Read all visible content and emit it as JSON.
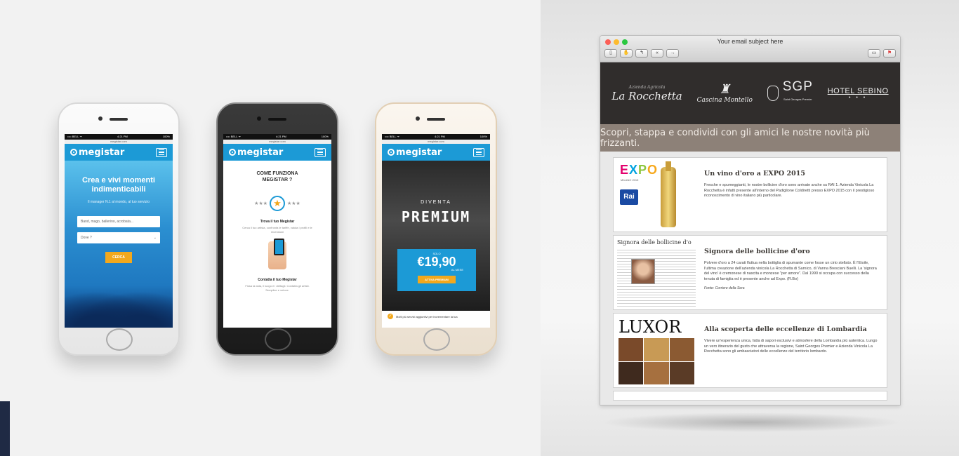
{
  "phones": {
    "p1": {
      "status_left": "•••• BELL ᯤ",
      "status_time": "4:21 PM",
      "status_right": "100%",
      "url": "megistar.com",
      "logo": "megistar",
      "headline": "Crea e vivi momenti indimenticabili",
      "subline": "Il manager N.1 al mondo, al tuo servizio",
      "search_placeholder": "Band, mago, ballerino, acrobata...",
      "where_placeholder": "Dove ?",
      "search_button": "CERCA"
    },
    "p2": {
      "status_left": "•••• BELL ᯤ",
      "status_time": "4:21 PM",
      "status_right": "100%",
      "url": "megistar.com",
      "logo": "megistar",
      "headline": "COME FUNZIONA MEGISTAR ?",
      "step1_title": "Trova il tuo Megistar",
      "step1_text": "Cerca il tuo artista, confronta le tariffe, valuta i profili e le recensioni",
      "step2_title": "Contatta il tuo Megistar",
      "step2_text": "Fissa la data, il luogo e i dettagli. Contatta gli artisti. Semplice e veloce."
    },
    "p3": {
      "status_left": "•••• BELL ᯤ",
      "status_time": "4:21 PM",
      "status_right": "100%",
      "url": "megistar.com",
      "logo": "megistar",
      "diventa": "DIVENTA",
      "premium": "PREMIUM",
      "solo": "SOLO",
      "price": "€19,90",
      "al_mese": "AL MESE",
      "cta": "ATTIVA PREMIUM",
      "more": "Molti più servizi aggiuntivi per incrementare la tua"
    }
  },
  "mail": {
    "subject": "Your email subject here",
    "toolbar_icons": [
      "trash-icon",
      "junk-icon",
      "reply-icon",
      "reply-all-icon",
      "forward-icon"
    ],
    "toolbar_right_icons": [
      "print-icon",
      "flag-icon"
    ],
    "brands": {
      "b1": "La Rocchetta",
      "b1_small": "Azienda Agricola",
      "b2": "Cascina Montello",
      "b3": "SGP",
      "b3_small": "Saint Georges Premier",
      "b4": "HOTEL SEBINO",
      "b4_small": "• • •"
    },
    "tagline": "Scopri, stappa e condividi con gli amici le nostre novità più frizzanti.",
    "cards": [
      {
        "title": "Un vino d'oro a EXPO 2015",
        "body": "Fresche e spumeggianti, le nostre bollicine d'oro sono arrivate anche su RAI 1. Azienda Vinicola La Rocchetta è infatti presente all'interno del Padiglione Coldiretti presso EXPO 2015 con il prestigioso riconoscimento di vino italiano più particolare.",
        "expo_logo": "EXPO",
        "expo_sub": "MILANO 2015",
        "rai_logo": "Rai"
      },
      {
        "title": "Signora delle bollicine d'oro",
        "body": "Polvere d'oro a 24 carati fluttua nella bottiglia di spumante come fosse un cirio stellato. È l'Etoile, l'ultima creazione dell'azienda vinicola La Rocchetta di Sarnico, di Vanna Bresciani Buelli. La 'signora del vino' è cremonese di nascita e monzese \"per amore\". Dal 1990 si occupa con successo della tenuta di famiglia ed è presente anche ad Expo. (R.Bo)",
        "source": "Fonte: Corriere della Sera",
        "clip_head": "Signora delle bollicine d'o"
      },
      {
        "title": "Alla scoperta delle eccellenze di Lombardia",
        "body": "Vivere un'esperienza unica, fatta di sapori esclusivi e atmosfere della Lombardia più autentica. Lungo un vero itinerario del gusto che attraversa la regione, Saint Georges Premier e Azienda Vinicola La Rocchetta sono gli ambasciatori delle eccellenze del territorio lombardo.",
        "luxor": "LUXOR"
      }
    ]
  },
  "colors": {
    "megistar_blue": "#1c9ad6",
    "accent_orange": "#f2a81d",
    "brand_dark": "#302d2c",
    "tagline_bg": "#8d8178"
  }
}
